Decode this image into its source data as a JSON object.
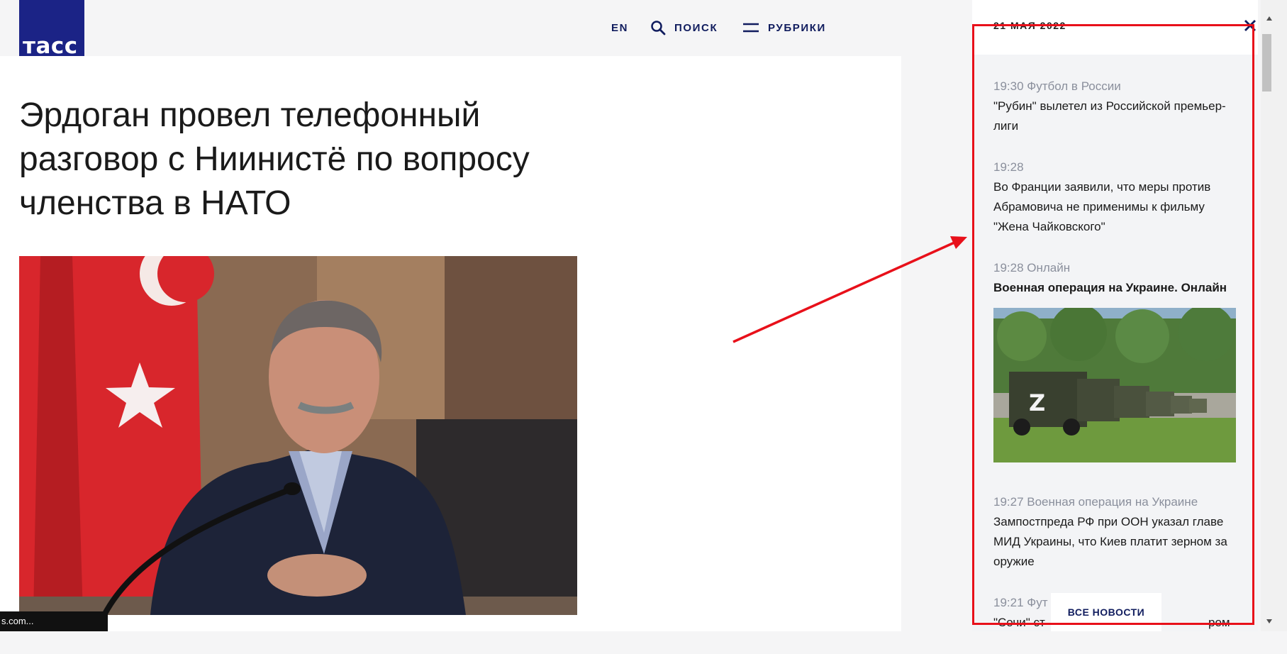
{
  "header": {
    "logo_text": "тасс",
    "lang": "EN",
    "search_label": "ПОИСК",
    "rubrics_label": "РУБРИКИ"
  },
  "article": {
    "headline": "Эрдоган провел телефонный разговор с Ниинистё по вопросу членства в НАТО"
  },
  "status_bar": {
    "text": "s.com..."
  },
  "sidebar": {
    "date": "21 МАЯ 2022",
    "items": [
      {
        "meta": "19:30 Футбол в России",
        "title": "\"Рубин\" вылетел из Российской премьер-лиги",
        "bold": false
      },
      {
        "meta": "19:28",
        "title": "Во Франции заявили, что меры против Абрамовича не применимы к фильму \"Жена Чайковского\"",
        "bold": false
      },
      {
        "meta": "19:28 Онлайн",
        "title": "Военная операция на Украине. Онлайн",
        "bold": true
      },
      {
        "meta": "19:27 Военная операция на Украине",
        "title": "Зампостпреда РФ при ООН указал главе МИД Украины, что Киев платит зерном за оружие",
        "bold": false
      },
      {
        "meta": "19:21 Фут",
        "title": "\"Сочи\" ст",
        "tail": "ром",
        "bold": false
      }
    ],
    "all_news_label": "ВСЕ НОВОСТИ"
  },
  "colors": {
    "brand": "#1b2386",
    "annotation": "#e8101a"
  }
}
